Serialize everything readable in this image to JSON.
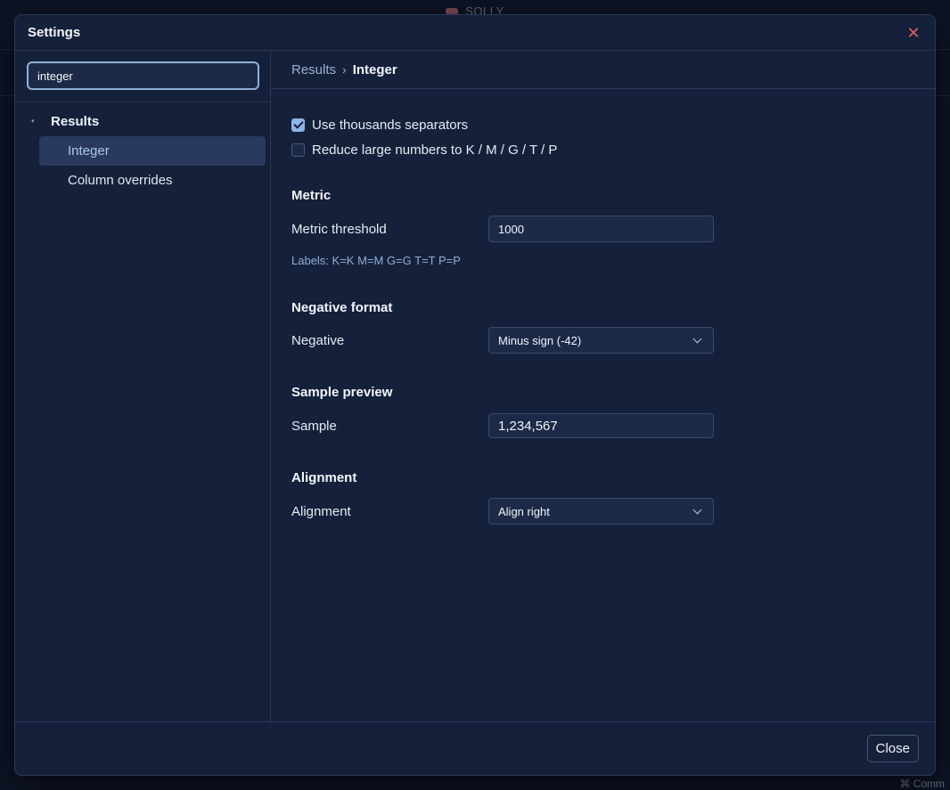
{
  "background": {
    "app_title": "SQLLY",
    "status_text": "⌘ Comm"
  },
  "dialog": {
    "title": "Settings",
    "close_label": "Close"
  },
  "sidebar": {
    "search_value": "integer",
    "group_label": "Results",
    "items": [
      {
        "label": "Integer",
        "active": true
      },
      {
        "label": "Column overrides",
        "active": false
      }
    ]
  },
  "breadcrumb": {
    "parent": "Results",
    "separator": "›",
    "current": "Integer"
  },
  "options": {
    "thousands_label": "Use thousands separators",
    "thousands_checked": true,
    "reduce_label": "Reduce large numbers to K / M / G / T / P",
    "reduce_checked": false
  },
  "metric": {
    "section_title": "Metric",
    "threshold_label": "Metric threshold",
    "threshold_value": "1000",
    "labels_hint": "Labels: K=K M=M G=G T=T P=P"
  },
  "negative": {
    "section_title": "Negative format",
    "label": "Negative",
    "selected": "Minus sign (-42)"
  },
  "sample": {
    "section_title": "Sample preview",
    "label": "Sample",
    "value": "1,234,567"
  },
  "alignment": {
    "section_title": "Alignment",
    "label": "Alignment",
    "selected": "Align right"
  },
  "colors": {
    "accent": "#8cb4e6",
    "close_icon": "#e0605a",
    "dialog_bg": "#15203a"
  }
}
